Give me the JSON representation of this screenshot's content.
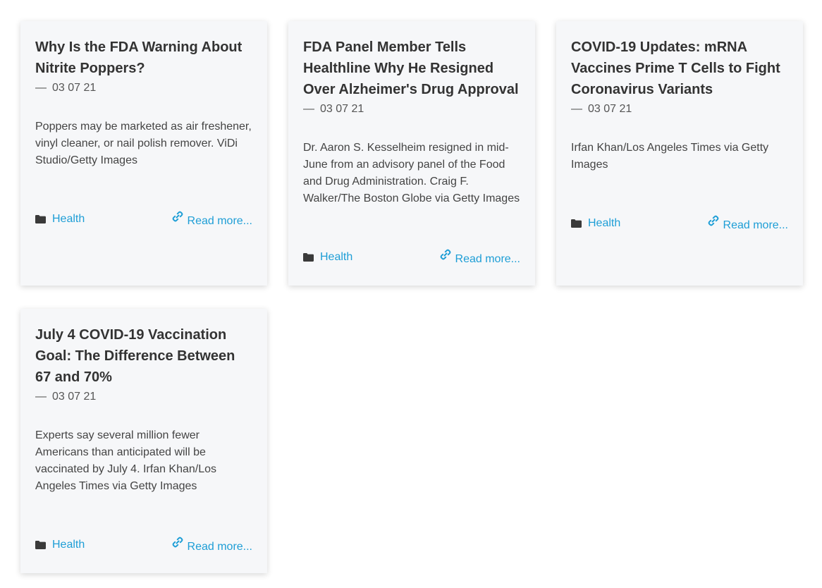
{
  "cards": [
    {
      "title": "Why Is the FDA Warning About Nitrite Poppers?",
      "date": "03 07 21",
      "excerpt": "Poppers may be marketed as air freshener, vinyl cleaner, or nail polish remover. ViDi Studio/Getty Images",
      "category": "Health",
      "read_more": "Read more..."
    },
    {
      "title": "FDA Panel Member Tells Healthline Why He Resigned Over Alzheimer's Drug Approval",
      "date": "03 07 21",
      "excerpt": "Dr. Aaron S. Kesselheim resigned in mid-June from an advisory panel of the Food and Drug Administration. Craig F. Walker/The Boston Globe via Getty Images",
      "category": "Health",
      "read_more": "Read more..."
    },
    {
      "title": "COVID-19 Updates: mRNA Vaccines Prime T Cells to Fight Coronavirus Variants",
      "date": "03 07 21",
      "excerpt": "Irfan Khan/Los Angeles Times via Getty Images",
      "category": "Health",
      "read_more": "Read more..."
    },
    {
      "title": "July 4 COVID-19 Vaccination Goal: The Difference Between 67 and 70%",
      "date": "03 07 21",
      "excerpt": "Experts say several million fewer Americans than anticipated will be vaccinated by July 4. Irfan Khan/Los Angeles Times via Getty Images",
      "category": "Health",
      "read_more": "Read more..."
    }
  ],
  "colors": {
    "card_bg": "#f6f7f9",
    "accent": "#1e9ed6",
    "title": "#333333"
  },
  "icons": {
    "date_prefix": "dash-icon",
    "category": "folder-icon",
    "read_more": "link-icon"
  }
}
